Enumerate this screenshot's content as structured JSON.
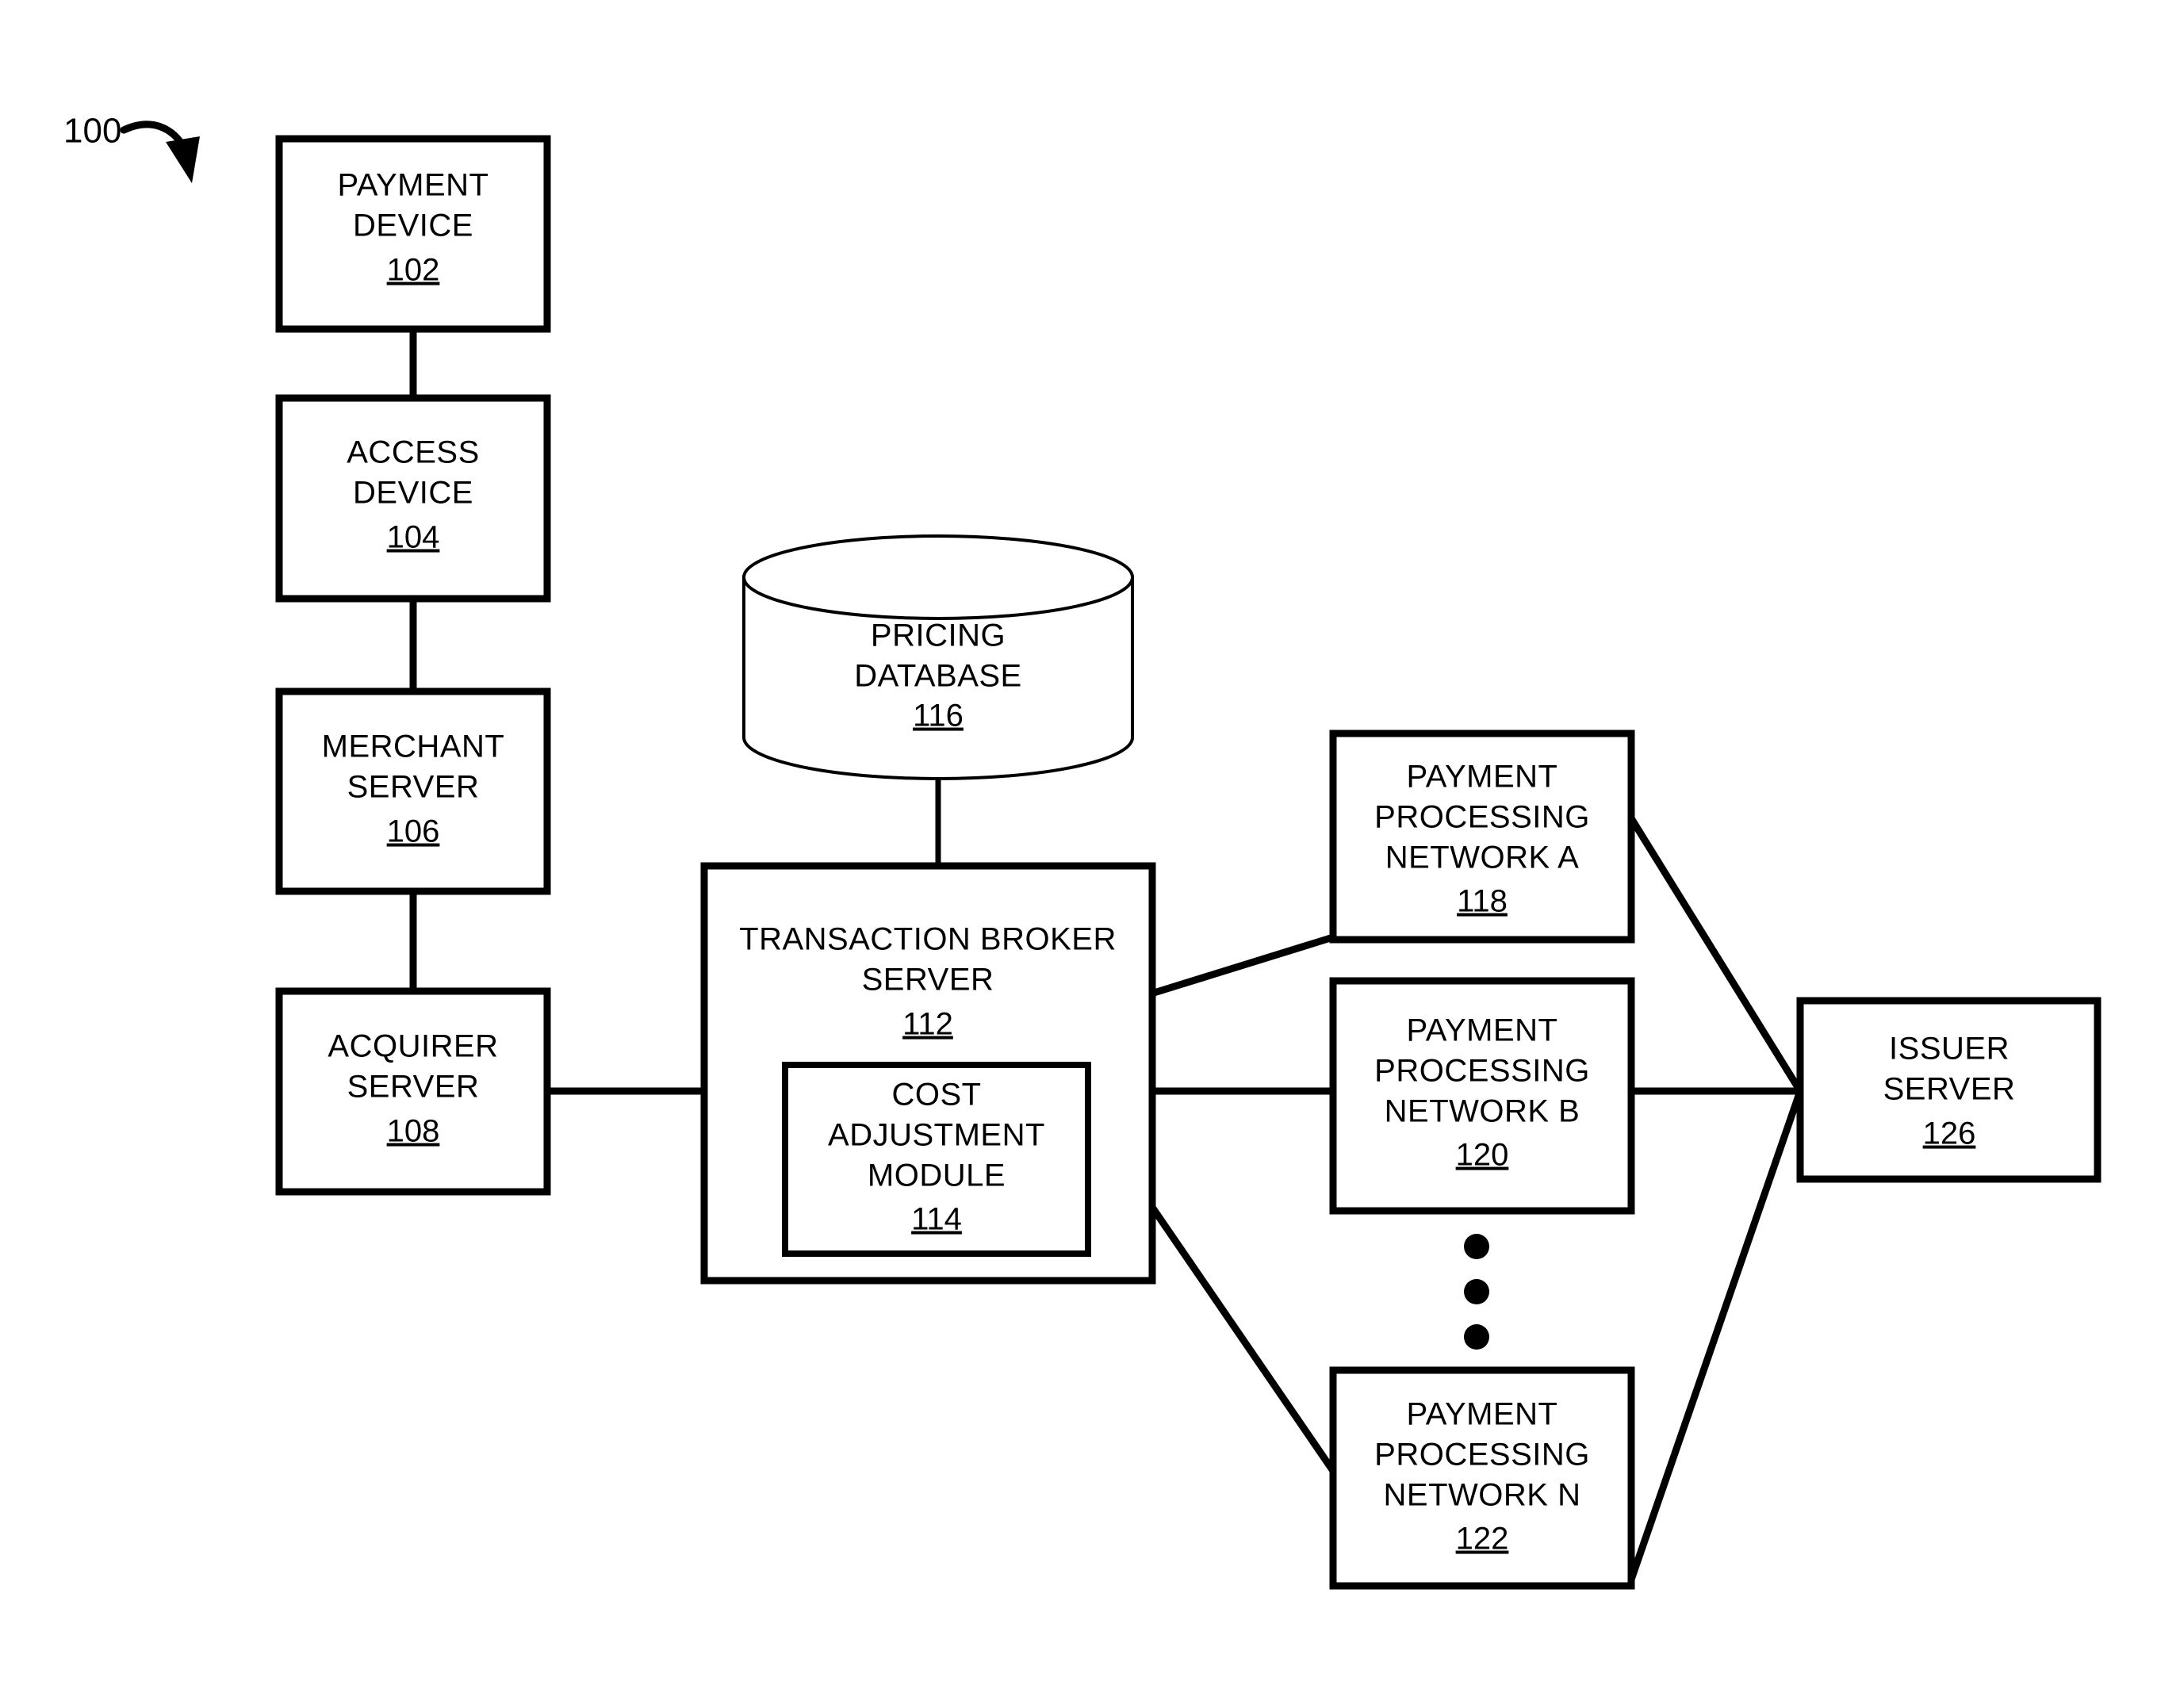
{
  "figure": {
    "number": "100",
    "arrow_icon": "curved-arrow-icon"
  },
  "nodes": {
    "payment_device": {
      "line1": "PAYMENT",
      "line2": "DEVICE",
      "ref": "102"
    },
    "access_device": {
      "line1": "ACCESS",
      "line2": "DEVICE",
      "ref": "104"
    },
    "merchant_server": {
      "line1": "MERCHANT",
      "line2": "SERVER",
      "ref": "106"
    },
    "acquirer_server": {
      "line1": "ACQUIRER",
      "line2": "SERVER",
      "ref": "108"
    },
    "transaction_broker_server": {
      "line1": "TRANSACTION BROKER",
      "line2": "SERVER",
      "ref": "112"
    },
    "cost_adjustment_module": {
      "line1": "COST",
      "line2": "ADJUSTMENT",
      "line3": "MODULE",
      "ref": "114"
    },
    "pricing_database": {
      "line1": "PRICING",
      "line2": "DATABASE",
      "ref": "116"
    },
    "payment_processing_network_a": {
      "line1": "PAYMENT",
      "line2": "PROCESSING",
      "line3": "NETWORK A",
      "ref": "118"
    },
    "payment_processing_network_b": {
      "line1": "PAYMENT",
      "line2": "PROCESSING",
      "line3": "NETWORK B",
      "ref": "120"
    },
    "payment_processing_network_n": {
      "line1": "PAYMENT",
      "line2": "PROCESSING",
      "line3": "NETWORK N",
      "ref": "122"
    },
    "issuer_server": {
      "line1": "ISSUER",
      "line2": "SERVER",
      "ref": "126"
    }
  },
  "ellipsis": {
    "label": "vertical-ellipsis",
    "dot_count": 3
  },
  "colors": {
    "stroke": "#000000",
    "fill": "#ffffff"
  }
}
